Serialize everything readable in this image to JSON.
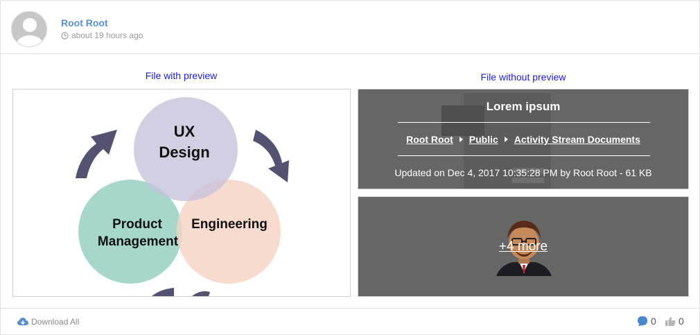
{
  "post": {
    "author": "Root Root",
    "timestamp": "about 19 hours ago"
  },
  "files": {
    "with_preview_title": "File with preview",
    "without_preview_title": "File without preview",
    "diagram": {
      "top_line1": "UX",
      "top_line2": "Design",
      "left_line1": "Product",
      "left_line2": "Management",
      "right_label": "Engineering"
    },
    "document": {
      "name": "Lorem ipsum",
      "breadcrumb": [
        "Root Root",
        "Public",
        "Activity Stream Documents"
      ],
      "meta": "Updated on Dec 4, 2017 10:35:28 PM by Root Root - 61 KB"
    },
    "more_label": "+4 more"
  },
  "footer": {
    "download_all": "Download All",
    "comments_count": "0",
    "likes_count": "0"
  },
  "colors": {
    "author_link": "#5b8fc9",
    "title_blue": "#1d1dd0",
    "tile_grey": "#666666",
    "circle_ux": "#c5c1da",
    "circle_product": "#9fd3c7",
    "circle_engineering": "#f7d3c4",
    "arrow": "#545270"
  }
}
